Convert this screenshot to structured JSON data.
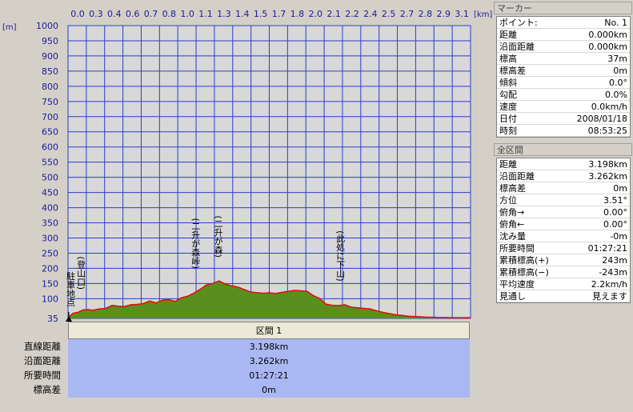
{
  "chart_data": {
    "type": "area",
    "x_unit": "[km]",
    "y_unit": "[m]",
    "xlim": [
      0,
      3.198
    ],
    "ylim": [
      35,
      1000
    ],
    "x_ticks": [
      "0.0",
      "0.3",
      "0.4",
      "0.6",
      "0.7",
      "0.8",
      "1.0",
      "1.1",
      "1.3",
      "1.4",
      "1.5",
      "1.7",
      "1.8",
      "2.0",
      "2.1",
      "2.2",
      "2.4",
      "2.5",
      "2.7",
      "2.8",
      "2.9",
      "3.1"
    ],
    "y_ticks": [
      "1000",
      "950",
      "900",
      "850",
      "800",
      "750",
      "700",
      "650",
      "600",
      "550",
      "500",
      "450",
      "400",
      "350",
      "300",
      "250",
      "200",
      "150",
      "100",
      "35"
    ],
    "series": [
      {
        "x": [
          0,
          0.04,
          0.08,
          0.12,
          0.16,
          0.2,
          0.25,
          0.3,
          0.35,
          0.4,
          0.45,
          0.5,
          0.55,
          0.6,
          0.65,
          0.7,
          0.75,
          0.8,
          0.85,
          0.9,
          0.95,
          1.0,
          1.05,
          1.1,
          1.15,
          1.2,
          1.25,
          1.3,
          1.35,
          1.4,
          1.45,
          1.5,
          1.55,
          1.6,
          1.65,
          1.7,
          1.75,
          1.8,
          1.85,
          1.9,
          1.95,
          2.0,
          2.05,
          2.1,
          2.15,
          2.2,
          2.25,
          2.3,
          2.35,
          2.4,
          2.45,
          2.5,
          2.55,
          2.6,
          2.65,
          2.7,
          2.75,
          2.8,
          2.85,
          2.9,
          2.95,
          3.0,
          3.05,
          3.1,
          3.15,
          3.198
        ],
        "y": [
          37,
          52,
          55,
          63,
          64,
          62,
          66,
          68,
          78,
          75,
          74,
          80,
          81,
          84,
          92,
          86,
          95,
          97,
          91,
          103,
          108,
          118,
          131,
          145,
          150,
          158,
          148,
          142,
          138,
          130,
          122,
          120,
          118,
          119,
          117,
          121,
          124,
          127,
          126,
          124,
          110,
          100,
          82,
          78,
          77,
          80,
          72,
          70,
          68,
          66,
          60,
          55,
          51,
          47,
          45,
          42,
          41,
          40,
          39,
          39,
          38,
          38,
          37,
          37,
          37,
          37
        ]
      }
    ],
    "annotations": [
      {
        "text": "駐車地点",
        "x": 0.0
      },
      {
        "text": "(登山口)",
        "x": 0.09
      },
      {
        "text": "(二升が森峠)",
        "x": 1.0
      },
      {
        "text": "(二升が森)",
        "x": 1.18
      },
      {
        "text": "(此処に下山)",
        "x": 2.15
      }
    ],
    "grid": true,
    "colors": {
      "fill": "#5a8f1e",
      "line": "#e01010",
      "grid": "#2b3ec8",
      "background": "#d8d8d8"
    }
  },
  "section": {
    "header": "区間 1",
    "rows": [
      {
        "label": "直線距離",
        "value": "3.198km"
      },
      {
        "label": "沿面距離",
        "value": "3.262km"
      },
      {
        "label": "所要時間",
        "value": "01:27:21"
      },
      {
        "label": "標高差",
        "value": "0m"
      }
    ]
  },
  "marker_panel": {
    "title": "マーカー",
    "rows": [
      {
        "label": "ポイント:",
        "value": "No. 1"
      },
      {
        "label": "距離",
        "value": "0.000km"
      },
      {
        "label": "沿面距離",
        "value": "0.000km"
      },
      {
        "label": "標高",
        "value": "37m"
      },
      {
        "label": "標高差",
        "value": "0m"
      },
      {
        "label": "傾斜",
        "value": "0.0°"
      },
      {
        "label": "勾配",
        "value": "0.0%"
      },
      {
        "label": "速度",
        "value": "0.0km/h"
      },
      {
        "label": "日付",
        "value": "2008/01/18"
      },
      {
        "label": "時刻",
        "value": "08:53:25"
      }
    ]
  },
  "total_panel": {
    "title": "全区間",
    "rows": [
      {
        "label": "距離",
        "value": "3.198km"
      },
      {
        "label": "沿面距離",
        "value": "3.262km"
      },
      {
        "label": "標高差",
        "value": "0m"
      },
      {
        "label": "方位",
        "value": "3.51°"
      },
      {
        "label": "俯角→",
        "value": "0.00°"
      },
      {
        "label": "俯角←",
        "value": "0.00°"
      },
      {
        "label": "沈み量",
        "value": "-0m"
      },
      {
        "label": "所要時間",
        "value": "01:27:21"
      },
      {
        "label": "累積標高(+)",
        "value": "243m"
      },
      {
        "label": "累積標高(−)",
        "value": "-243m"
      },
      {
        "label": "平均速度",
        "value": "2.2km/h"
      },
      {
        "label": "見通し",
        "value": "見えます"
      }
    ]
  }
}
